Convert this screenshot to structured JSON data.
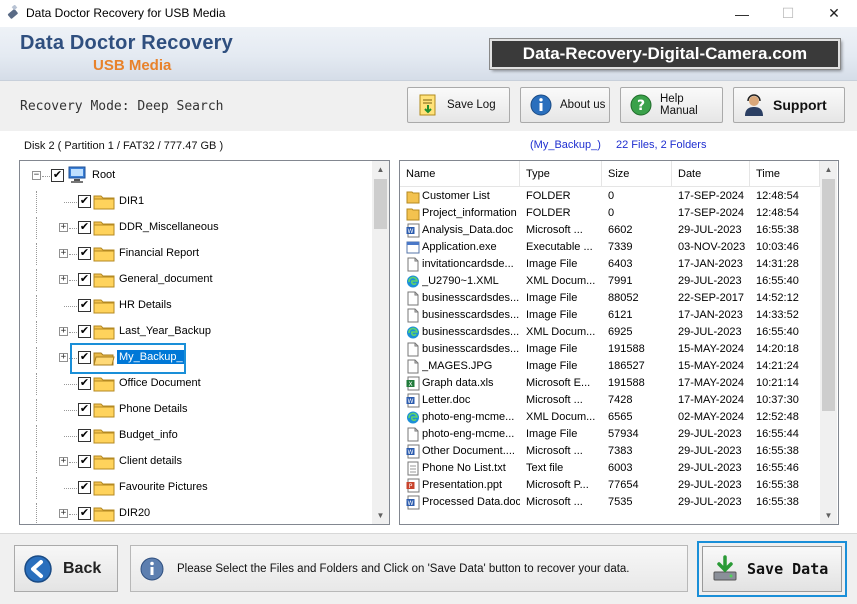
{
  "window": {
    "title": "Data Doctor Recovery for USB Media",
    "minimize": "—",
    "maximize": "☐",
    "close": "✕"
  },
  "header": {
    "brand": "Data Doctor Recovery",
    "brand_sub": "USB Media",
    "website": "Data-Recovery-Digital-Camera.com"
  },
  "toolbar": {
    "mode_text": "Recovery Mode: Deep Search",
    "save_log": "Save Log",
    "about_us": "About us",
    "help_manual": "Help Manual",
    "support": "Support"
  },
  "tree": {
    "disk_info": "Disk 2 ( Partition 1 / FAT32 / 777.47 GB )",
    "root_label": "Root",
    "items": [
      {
        "label": "DIR1",
        "expandable": false
      },
      {
        "label": "DDR_Miscellaneous",
        "expandable": true
      },
      {
        "label": "Financial Report",
        "expandable": true
      },
      {
        "label": "General_document",
        "expandable": true
      },
      {
        "label": "HR Details",
        "expandable": false
      },
      {
        "label": "Last_Year_Backup",
        "expandable": true
      },
      {
        "label": "My_Backup_",
        "expandable": true,
        "selected": true
      },
      {
        "label": "Office Document",
        "expandable": false
      },
      {
        "label": "Phone Details",
        "expandable": false
      },
      {
        "label": "Budget_info",
        "expandable": false
      },
      {
        "label": "Client details",
        "expandable": true
      },
      {
        "label": "Favourite Pictures",
        "expandable": false
      },
      {
        "label": "DIR20",
        "expandable": true
      }
    ]
  },
  "list": {
    "path": "(My_Backup_)",
    "summary": "22 Files, 2 Folders",
    "columns": [
      "Name",
      "Type",
      "Size",
      "Date",
      "Time"
    ],
    "rows": [
      {
        "icon": "folder",
        "name": "Customer List",
        "type": "FOLDER",
        "size": "0",
        "date": "17-SEP-2024",
        "time": "12:48:54"
      },
      {
        "icon": "folder",
        "name": "Project_information",
        "type": "FOLDER",
        "size": "0",
        "date": "17-SEP-2024",
        "time": "12:48:54"
      },
      {
        "icon": "word",
        "name": "Analysis_Data.doc",
        "type": "Microsoft ...",
        "size": "6602",
        "date": "29-JUL-2023",
        "time": "16:55:38"
      },
      {
        "icon": "exe",
        "name": "Application.exe",
        "type": "Executable ...",
        "size": "7339",
        "date": "03-NOV-2023",
        "time": "10:03:46"
      },
      {
        "icon": "file",
        "name": "invitationcardsde...",
        "type": "Image File",
        "size": "6403",
        "date": "17-JAN-2023",
        "time": "14:31:28"
      },
      {
        "icon": "edge",
        "name": "_U2790~1.XML",
        "type": "XML Docum...",
        "size": "7991",
        "date": "29-JUL-2023",
        "time": "16:55:40"
      },
      {
        "icon": "file",
        "name": "businesscardsdes...",
        "type": "Image File",
        "size": "88052",
        "date": "22-SEP-2017",
        "time": "14:52:12"
      },
      {
        "icon": "file",
        "name": "businesscardsdes...",
        "type": "Image File",
        "size": "6121",
        "date": "17-JAN-2023",
        "time": "14:33:52"
      },
      {
        "icon": "edge",
        "name": "businesscardsdes...",
        "type": "XML Docum...",
        "size": "6925",
        "date": "29-JUL-2023",
        "time": "16:55:40"
      },
      {
        "icon": "file",
        "name": "businesscardsdes...",
        "type": "Image File",
        "size": "191588",
        "date": "15-MAY-2024",
        "time": "14:20:18"
      },
      {
        "icon": "file",
        "name": "_MAGES.JPG",
        "type": "Image File",
        "size": "186527",
        "date": "15-MAY-2024",
        "time": "14:21:24"
      },
      {
        "icon": "excel",
        "name": "Graph data.xls",
        "type": "Microsoft E...",
        "size": "191588",
        "date": "17-MAY-2024",
        "time": "10:21:14"
      },
      {
        "icon": "word",
        "name": "Letter.doc",
        "type": "Microsoft ...",
        "size": "7428",
        "date": "17-MAY-2024",
        "time": "10:37:30"
      },
      {
        "icon": "edge",
        "name": "photo-eng-mcme...",
        "type": "XML Docum...",
        "size": "6565",
        "date": "02-MAY-2024",
        "time": "12:52:48"
      },
      {
        "icon": "file",
        "name": "photo-eng-mcme...",
        "type": "Image File",
        "size": "57934",
        "date": "29-JUL-2023",
        "time": "16:55:44"
      },
      {
        "icon": "word",
        "name": "Other Document....",
        "type": "Microsoft ...",
        "size": "7383",
        "date": "29-JUL-2023",
        "time": "16:55:38"
      },
      {
        "icon": "text",
        "name": "Phone No List.txt",
        "type": "Text file",
        "size": "6003",
        "date": "29-JUL-2023",
        "time": "16:55:46"
      },
      {
        "icon": "ppt",
        "name": "Presentation.ppt",
        "type": "Microsoft P...",
        "size": "77654",
        "date": "29-JUL-2023",
        "time": "16:55:38"
      },
      {
        "icon": "word",
        "name": "Processed Data.doc",
        "type": "Microsoft ...",
        "size": "7535",
        "date": "29-JUL-2023",
        "time": "16:55:38"
      }
    ]
  },
  "footer": {
    "back": "Back",
    "message": "Please Select the Files and Folders and Click on 'Save Data' button to recover your data.",
    "save_data": "Save Data"
  },
  "colors": {
    "brand": "#2f4f7f",
    "brand_sub": "#e8822b",
    "path_text": "#1f2fd0",
    "selection": "#0078d7",
    "focus_border": "#1a8fd8"
  }
}
